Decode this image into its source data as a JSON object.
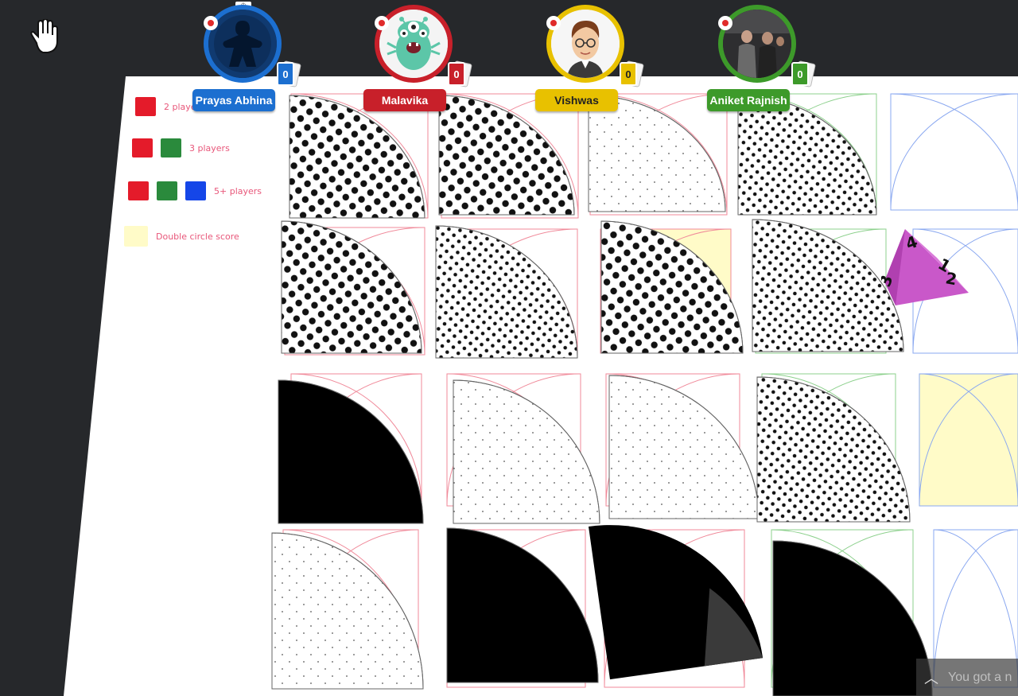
{
  "legend": [
    {
      "colors": [
        "#e41b2a"
      ],
      "label": "2 players"
    },
    {
      "colors": [
        "#e41b2a",
        "#2a8a3c"
      ],
      "label": "3 players"
    },
    {
      "colors": [
        "#e41b2a",
        "#2a8a3c",
        "#1546e8"
      ],
      "label": "5+ players"
    },
    {
      "colors": [
        "#fffbc8"
      ],
      "label": "Double circle score"
    }
  ],
  "players": [
    {
      "name": "Prayas Abhina",
      "cards": "0",
      "color": "#1c6fd0",
      "avatar": "meeple-avatar"
    },
    {
      "name": "Malavika",
      "cards": "0",
      "color": "#c8202a",
      "avatar": "monster-avatar"
    },
    {
      "name": "Vishwas",
      "cards": "0",
      "color": "#e8c100",
      "avatar": "man-glasses-avatar"
    },
    {
      "name": "Aniket Rajnish",
      "cards": "0",
      "color": "#3d9a2a",
      "avatar": "photo-avatar"
    }
  ],
  "die": {
    "faces": [
      "4",
      "1",
      "2",
      "3"
    ],
    "color": "#c958c9"
  },
  "notification": {
    "text": "You got a n"
  },
  "colors": {
    "background": "#26282b",
    "board": "#ffffff"
  }
}
